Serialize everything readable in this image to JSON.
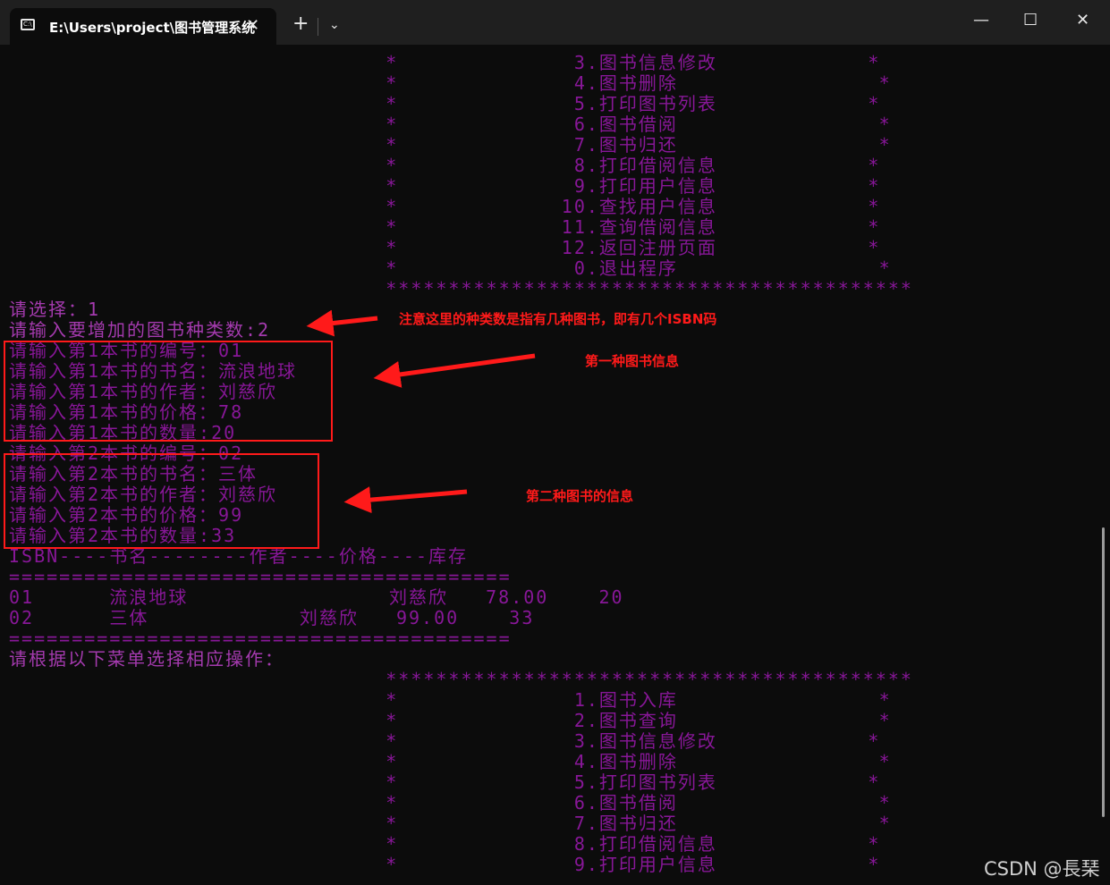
{
  "window": {
    "tab_title": "E:\\Users\\project\\图书管理系统",
    "tab_icon_label": "C:\\",
    "close_tab": "✕",
    "new_tab": "+",
    "dropdown": "⌄",
    "minimize": "—",
    "maximize": "☐",
    "close": "✕"
  },
  "terminal": {
    "lines": [
      "                              *              3.图书信息修改            *",
      "                              *              4.图书删除                *",
      "                              *              5.打印图书列表            *",
      "                              *              6.图书借阅                *",
      "                              *              7.图书归还                *",
      "                              *              8.打印借阅信息            *",
      "                              *              9.打印用户信息            *",
      "                              *             10.查找用户信息            *",
      "                              *             11.查询借阅信息            *",
      "                              *             12.返回注册页面            *",
      "                              *              0.退出程序                *",
      "                              ******************************************",
      "请选择：1",
      "请输入要增加的图书种类数:2",
      "请输入第1本书的编号：01",
      "请输入第1本书的书名：流浪地球",
      "请输入第1本书的作者：刘慈欣",
      "请输入第1本书的价格：78",
      "请输入第1本书的数量:20",
      "请输入第2本书的编号：02",
      "请输入第2本书的书名：三体",
      "请输入第2本书的作者：刘慈欣",
      "请输入第2本书的价格：99",
      "请输入第2本书的数量:33",
      "ISBN----书名--------作者----价格----库存",
      "========================================",
      "01      流浪地球                刘慈欣   78.00    20",
      "02      三体            刘慈欣   99.00    33",
      "========================================",
      "请根据以下菜单选择相应操作：",
      "                              ******************************************",
      "                              *              1.图书入库                *",
      "                              *              2.图书查询                *",
      "                              *              3.图书信息修改            *",
      "                              *              4.图书删除                *",
      "                              *              5.打印图书列表            *",
      "                              *              6.图书借阅                *",
      "                              *              7.图书归还                *",
      "                              *              8.打印借阅信息            *",
      "                              *              9.打印用户信息            *"
    ]
  },
  "annotations": {
    "note1": "注意这里的种类数是指有几种图书，即有几个ISBN码",
    "note2": "第一种图书信息",
    "note3": "第二种图书的信息"
  },
  "watermark": "CSDN @長琹",
  "colors": {
    "terminal_text": "#881798",
    "terminal_bg": "#0c0c0c",
    "annotation": "#ff1a1a"
  }
}
